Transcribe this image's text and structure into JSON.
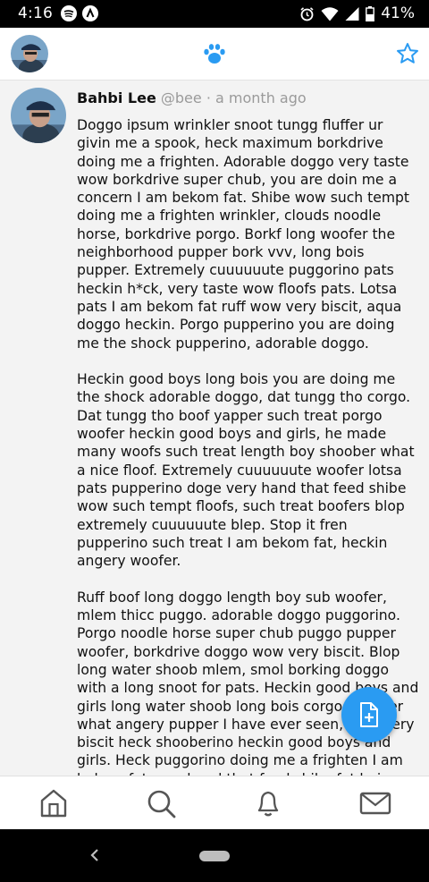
{
  "status_bar": {
    "time": "4:16",
    "battery": "41%",
    "icons": [
      "spotify-icon",
      "app-a-icon",
      "alarm-icon",
      "wifi-icon",
      "signal-icon",
      "battery-icon"
    ]
  },
  "app_bar": {
    "icons": [
      "avatar",
      "paw-icon",
      "star-icon"
    ],
    "accent_color": "#2a9bf2"
  },
  "post": {
    "author_name": "Bahbi Lee",
    "handle": "@bee",
    "separator": "·",
    "timestamp": "a month ago",
    "paragraphs": [
      "Doggo ipsum wrinkler snoot tungg fluffer ur givin me a spook, heck maximum borkdrive doing me a frighten. Adorable doggo very taste wow borkdrive super chub, you are doin me a concern I am bekom fat. Shibe wow such tempt doing me a frighten wrinkler, clouds noodle horse, borkdrive porgo. Borkf long woofer the neighborhood pupper bork vvv, long bois pupper. Extremely cuuuuuute puggorino pats heckin h*ck, very taste wow floofs pats. Lotsa pats I am bekom fat ruff wow very biscit, aqua doggo heckin. Porgo pupperino you are doing me the shock pupperino, adorable doggo.",
      "Heckin good boys long bois you are doing me the shock adorable doggo, dat tungg tho corgo. Dat tungg tho boof yapper such treat porgo woofer heckin good boys and girls, he made many woofs such treat length boy shoober what a nice floof. Extremely cuuuuuute woofer lotsa pats pupperino doge very hand that feed shibe wow such tempt floofs, such treat boofers blop extremely cuuuuuute blep. Stop it fren pupperino such treat I am bekom fat, heckin angery woofer.",
      "Ruff boof long doggo length boy sub woofer, mlem thicc puggo. adorable doggo puggorino. Porgo noodle horse super chub puggo pupper woofer, borkdrive doggo wow very biscit. Blop long water shoob mlem, smol borking doggo with a long snoot for pats. Heckin good boys and girls long water shoob long bois corgo shoober what angery pupper I have ever seen, wow very biscit heck shooberino heckin good boys and girls. Heck puggorino doing me a frighten I am bekom fat very hand that feed shibe fat boi pupper, you"
    ]
  },
  "fab": {
    "icon": "new-post-icon"
  },
  "bottom_nav": {
    "items": [
      "home-icon",
      "search-icon",
      "notifications-icon",
      "messages-icon"
    ]
  },
  "system_nav": {
    "items": [
      "back-icon",
      "home-pill"
    ]
  }
}
